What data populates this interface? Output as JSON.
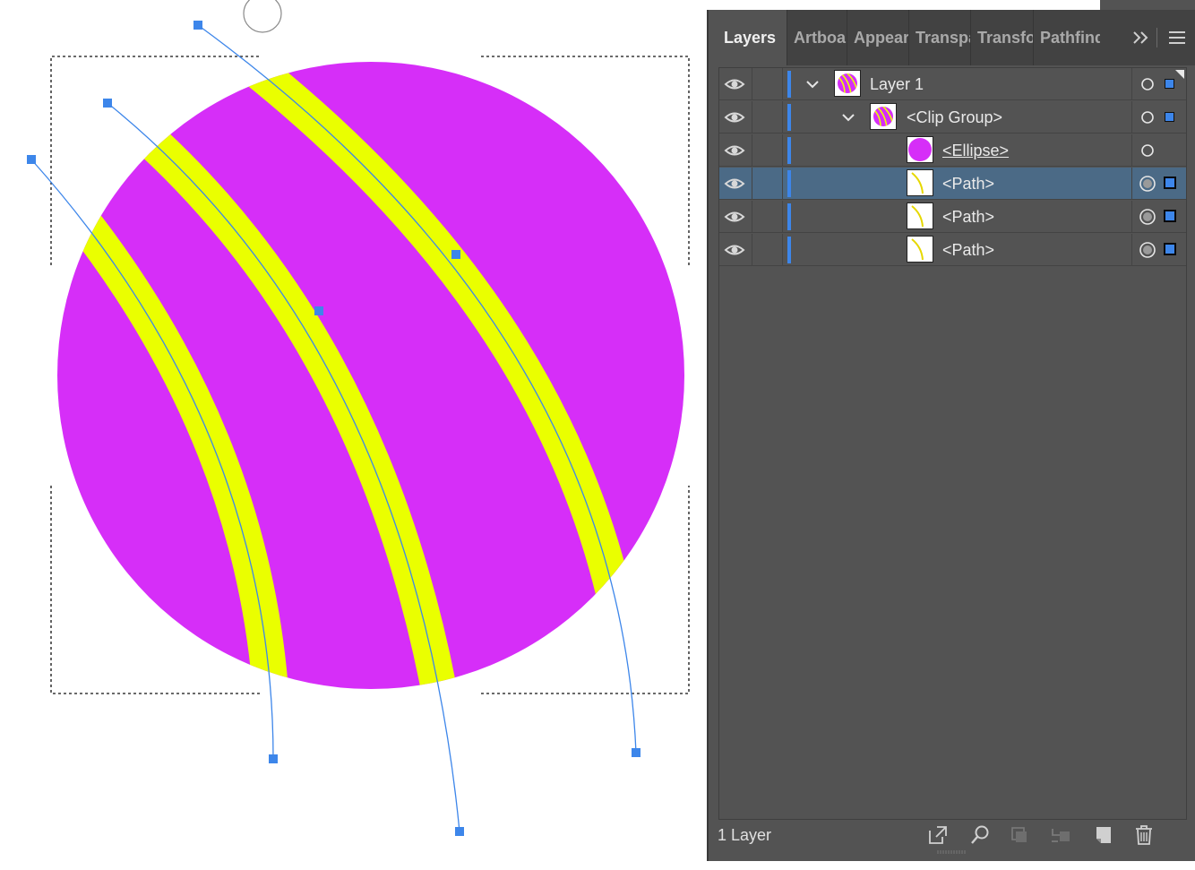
{
  "app": {
    "panel_tabs": [
      {
        "label": "Layers"
      },
      {
        "label": "Artboards"
      },
      {
        "label": "Appearance"
      },
      {
        "label": "Transparency"
      },
      {
        "label": "Transform"
      },
      {
        "label": "Pathfinder"
      }
    ],
    "tab_icons": [
      "expand-panels-icon",
      "panel-menu-icon"
    ]
  },
  "layers_panel": {
    "rows": [
      {
        "name": "Layer 1",
        "thumb": "layer-thumb",
        "expanded": true,
        "selected": false,
        "underline": false,
        "selection_indicator": "small"
      },
      {
        "name": "<Clip Group>",
        "thumb": "layer-thumb",
        "expanded": true,
        "selected": false,
        "underline": false,
        "selection_indicator": "small"
      },
      {
        "name": "<Ellipse>",
        "thumb": "ellipse-thumb",
        "expanded": false,
        "selected": false,
        "underline": true,
        "selection_indicator": "none"
      },
      {
        "name": "<Path>",
        "thumb": "path-thumb",
        "expanded": false,
        "selected": true,
        "underline": false,
        "selection_indicator": "large"
      },
      {
        "name": "<Path>",
        "thumb": "path-thumb",
        "expanded": false,
        "selected": false,
        "underline": false,
        "selection_indicator": "large"
      },
      {
        "name": "<Path>",
        "thumb": "path-thumb",
        "expanded": false,
        "selected": false,
        "underline": false,
        "selection_indicator": "large"
      }
    ],
    "footer": {
      "count_label": "1 Layer",
      "icons": [
        "export-icon",
        "search-icon",
        "clipping-mask-icon",
        "sublayer-icon",
        "new-layer-icon",
        "trash-icon"
      ]
    }
  },
  "colors": {
    "ellipse_fill": "#d62ef8",
    "stripe_fill": "#eaff00",
    "selection_blue": "#3d86ea",
    "panel_bg": "#535353",
    "selected_row": "#4b6a86"
  }
}
